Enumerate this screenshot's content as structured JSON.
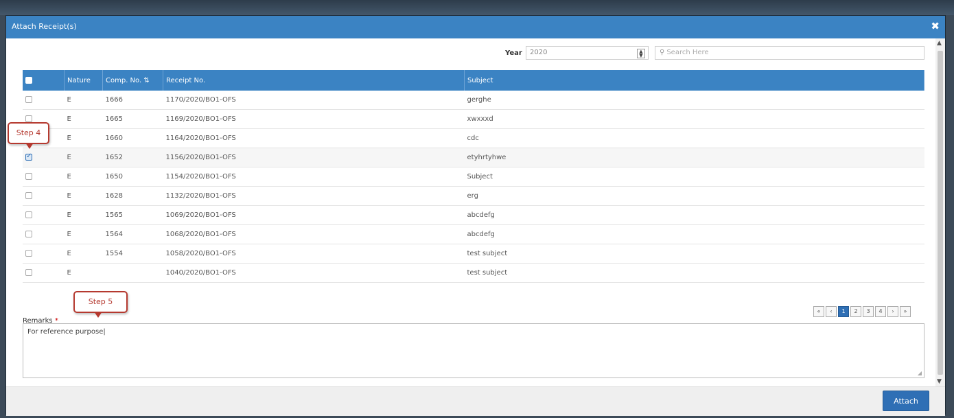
{
  "dialog": {
    "title": "Attach Receipt(s)",
    "close_icon": "close-icon"
  },
  "filters": {
    "year_label": "Year",
    "year_value": "2020",
    "search_placeholder": "Search Here"
  },
  "table": {
    "columns": [
      "Nature",
      "Comp. No.",
      "Receipt No.",
      "Subject"
    ],
    "rows": [
      {
        "nature": "E",
        "comp_no": "1666",
        "receipt_no": "1170/2020/BO1-OFS",
        "subject": "gerghe",
        "checked": false
      },
      {
        "nature": "E",
        "comp_no": "1665",
        "receipt_no": "1169/2020/BO1-OFS",
        "subject": "xwxxxd",
        "checked": false
      },
      {
        "nature": "E",
        "comp_no": "1660",
        "receipt_no": "1164/2020/BO1-OFS",
        "subject": "cdc",
        "checked": false
      },
      {
        "nature": "E",
        "comp_no": "1652",
        "receipt_no": "1156/2020/BO1-OFS",
        "subject": "etyhrtyhwe",
        "checked": true
      },
      {
        "nature": "E",
        "comp_no": "1650",
        "receipt_no": "1154/2020/BO1-OFS",
        "subject": "Subject",
        "checked": false
      },
      {
        "nature": "E",
        "comp_no": "1628",
        "receipt_no": "1132/2020/BO1-OFS",
        "subject": "erg",
        "checked": false
      },
      {
        "nature": "E",
        "comp_no": "1565",
        "receipt_no": "1069/2020/BO1-OFS",
        "subject": "abcdefg",
        "checked": false
      },
      {
        "nature": "E",
        "comp_no": "1564",
        "receipt_no": "1068/2020/BO1-OFS",
        "subject": "abcdefg",
        "checked": false
      },
      {
        "nature": "E",
        "comp_no": "1554",
        "receipt_no": "1058/2020/BO1-OFS",
        "subject": "test subject",
        "checked": false
      },
      {
        "nature": "E",
        "comp_no": "",
        "receipt_no": "1040/2020/BO1-OFS",
        "subject": "test subject",
        "checked": false
      }
    ]
  },
  "pager": {
    "first": "«",
    "prev": "‹",
    "pages": [
      "1",
      "2",
      "3",
      "4"
    ],
    "next": "›",
    "last": "»",
    "active": "1"
  },
  "remarks": {
    "label": "Remarks",
    "required_mark": "*",
    "value": "For reference purpose"
  },
  "footer": {
    "attach_label": "Attach"
  },
  "callouts": {
    "step4": "Step 4",
    "step5": "Step 5"
  },
  "colors": {
    "header_blue": "#3b83c3",
    "button_blue": "#2f6fb5",
    "callout_red": "#b5392f"
  }
}
